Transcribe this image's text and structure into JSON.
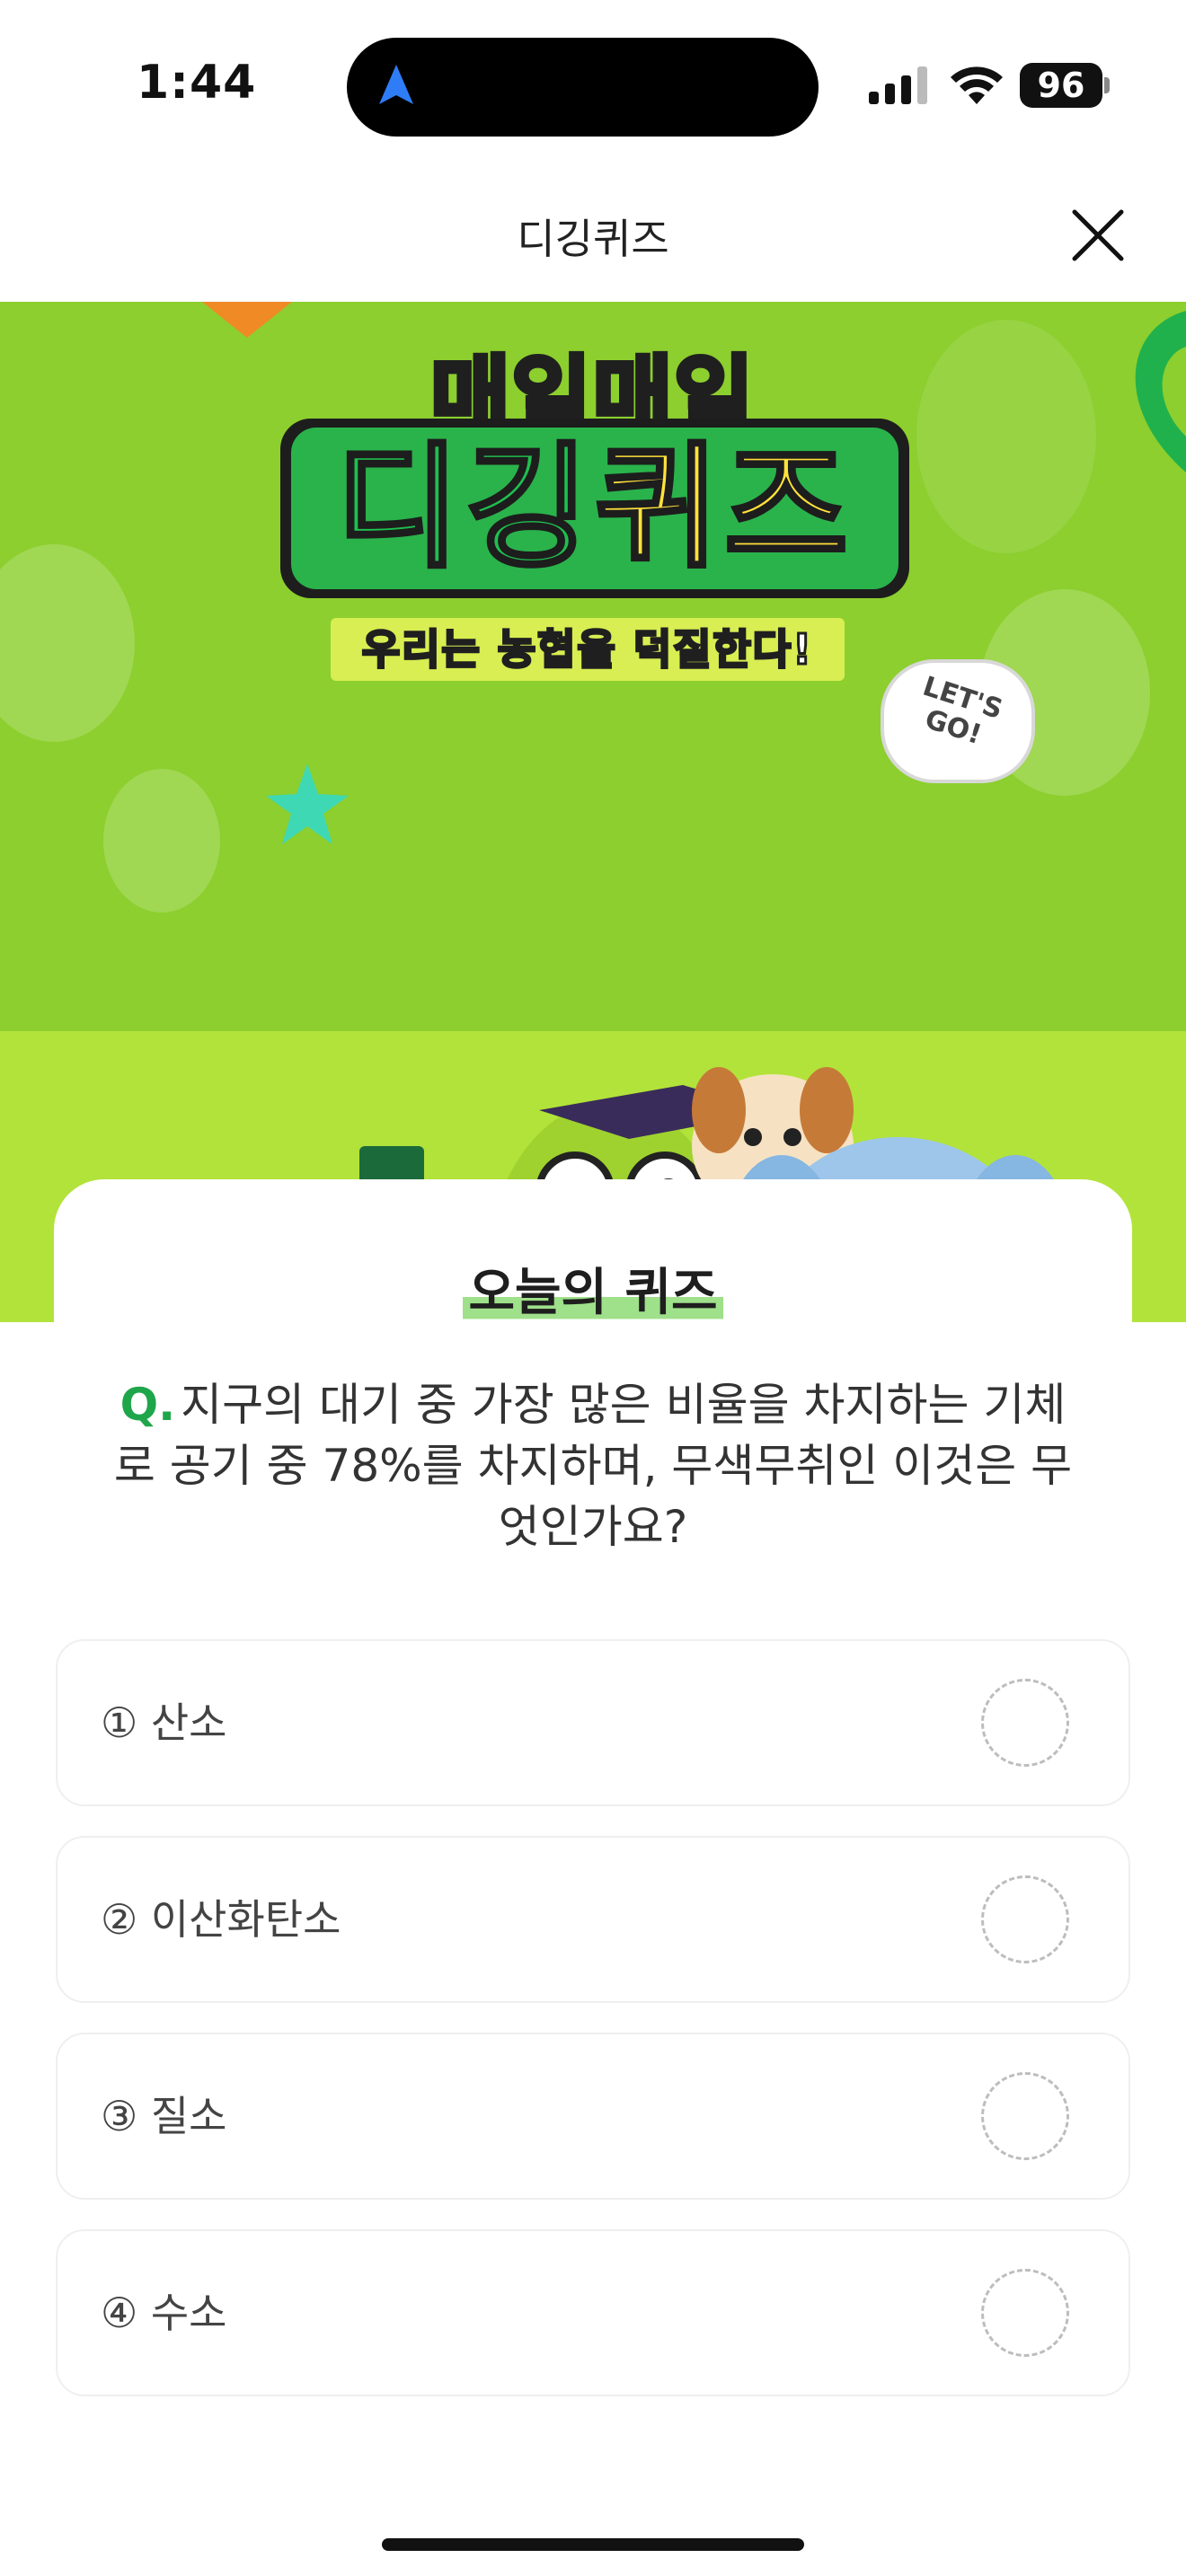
{
  "status_bar": {
    "time": "1:44",
    "battery": "96"
  },
  "header": {
    "title": "디깅퀴즈",
    "close_icon": "close-icon"
  },
  "banner": {
    "top_text": "매일매일",
    "title_part1": "디깅",
    "title_part2": "퀴즈",
    "subtitle": "우리는 농협을 덕질한다!",
    "speech_bubble": "LET'S GO!",
    "colors": {
      "background": "#8ccf2e",
      "floor": "#b2e33a",
      "title_green": "#1fbf4f",
      "title_yellow": "#ffe23a"
    }
  },
  "quiz": {
    "card_title": "오늘의 퀴즈",
    "question_prefix": "Q.",
    "question": "지구의 대기 중 가장 많은 비율을 차지하는 기체로 공기 중 78%를 차지하며, 무색무취인 이것은 무엇인가요?",
    "options": [
      {
        "label": "① 산소"
      },
      {
        "label": "② 이산화탄소"
      },
      {
        "label": "③ 질소"
      },
      {
        "label": "④ 수소"
      }
    ],
    "accent_color": "#1fa64b"
  }
}
